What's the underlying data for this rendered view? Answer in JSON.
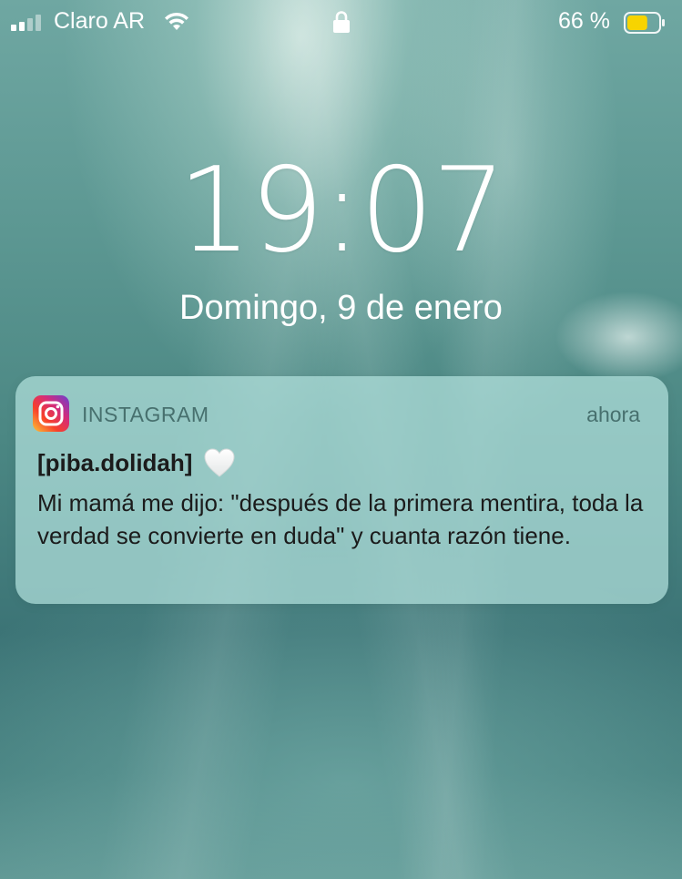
{
  "status_bar": {
    "carrier": "Claro AR",
    "battery_percent": "66 %",
    "battery_level": 0.66,
    "battery_color": "#f7d400",
    "icons": [
      "signal-icon",
      "wifi-icon",
      "lock-icon",
      "battery-icon"
    ]
  },
  "lockscreen": {
    "time": "19:07",
    "date": "Domingo, 9 de enero"
  },
  "notification": {
    "app_name": "INSTAGRAM",
    "time": "ahora",
    "title": "[piba.dolidah]",
    "title_emoji": "white-heart-icon",
    "body": "Mi mamá me dijo: \"después de la primera mentira, toda la verdad se convierte en duda\" y cuanta razón tiene.",
    "app_icon": "instagram-icon"
  }
}
